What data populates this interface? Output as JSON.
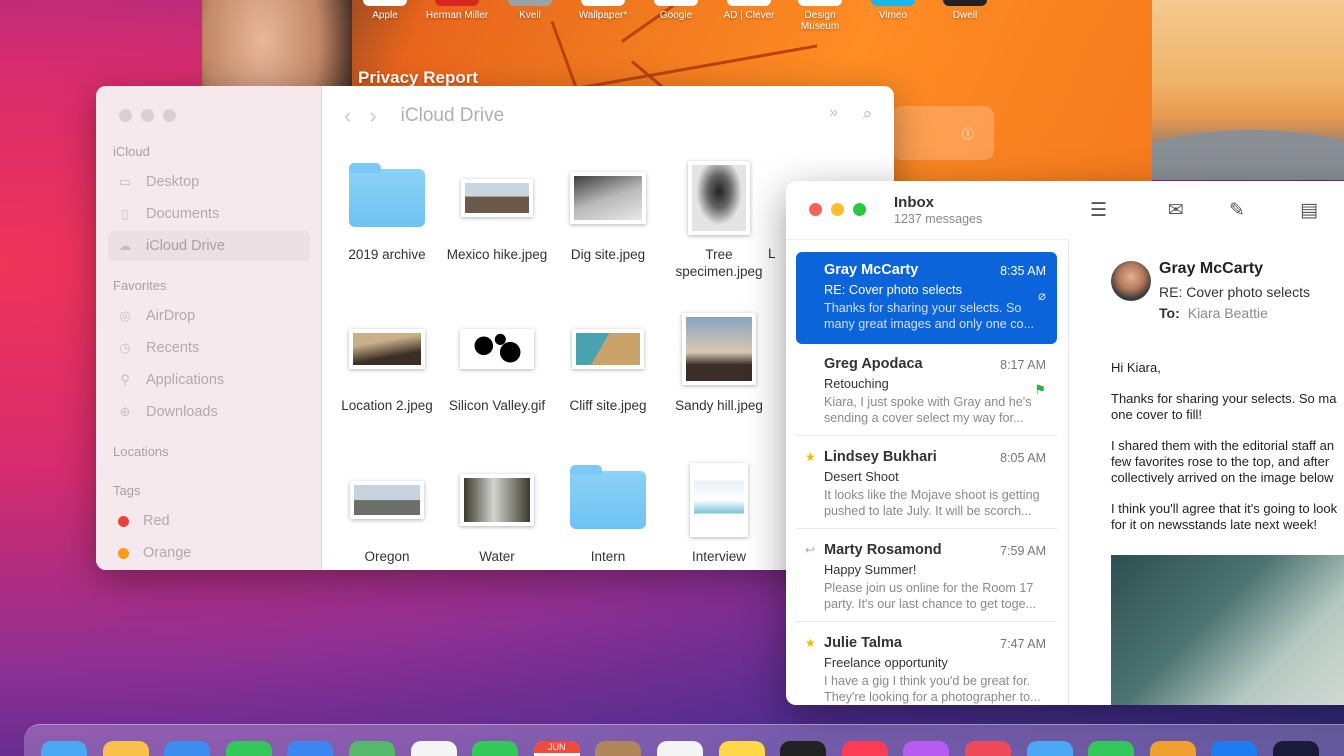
{
  "safari": {
    "favorites": [
      "Apple",
      "Herman Miller",
      "Kvell",
      "Wallpaper*",
      "Google",
      "AD | Clever",
      "Design Museum",
      "Vimeo",
      "Dwell"
    ],
    "privacy_title": "Privacy Report"
  },
  "finder": {
    "title": "iCloud Drive",
    "sections": {
      "icloud": "iCloud",
      "favorites": "Favorites",
      "locations": "Locations",
      "tags": "Tags"
    },
    "icloud_items": [
      {
        "label": "Desktop",
        "icon": "desktop-icon"
      },
      {
        "label": "Documents",
        "icon": "documents-icon"
      },
      {
        "label": "iCloud Drive",
        "icon": "cloud-icon",
        "selected": true
      }
    ],
    "favorite_items": [
      {
        "label": "AirDrop",
        "icon": "airdrop-icon"
      },
      {
        "label": "Recents",
        "icon": "clock-icon"
      },
      {
        "label": "Applications",
        "icon": "applications-icon"
      },
      {
        "label": "Downloads",
        "icon": "download-icon"
      }
    ],
    "tags": [
      {
        "label": "Red",
        "color": "#e8443a"
      },
      {
        "label": "Orange",
        "color": "#f59d18"
      }
    ],
    "files": [
      {
        "name": "2019 archive",
        "kind": "folder"
      },
      {
        "name": "Mexico hike.jpeg",
        "kind": "photo",
        "colors": [
          "#c8d6e0",
          "#6b5a4a"
        ]
      },
      {
        "name": "Dig site.jpeg",
        "kind": "photo",
        "colors": [
          "#d8d8d8",
          "#3c3c3c"
        ]
      },
      {
        "name": "Tree specimen.jpeg",
        "kind": "photo",
        "colors": [
          "#e4e4e4",
          "#222"
        ]
      },
      {
        "name": "Location 2.jpeg",
        "kind": "photo",
        "colors": [
          "#c9b08a",
          "#3b2e22"
        ]
      },
      {
        "name": "Silicon Valley.gif",
        "kind": "photo",
        "colors": [
          "#fff",
          "#000"
        ]
      },
      {
        "name": "Cliff site.jpeg",
        "kind": "photo",
        "colors": [
          "#4aa3b0",
          "#c9a36a"
        ]
      },
      {
        "name": "Sandy hill.jpeg",
        "kind": "photo",
        "colors": [
          "#d8c9b0",
          "#3a2e28"
        ]
      },
      {
        "name": "Oregon",
        "kind": "photo",
        "colors": [
          "#c8d2dc",
          "#6a6f6a"
        ]
      },
      {
        "name": "Water",
        "kind": "photo",
        "colors": [
          "#cfd5cf",
          "#3e3a2c"
        ]
      },
      {
        "name": "Intern",
        "kind": "folder"
      },
      {
        "name": "Interview",
        "kind": "doc"
      }
    ],
    "cut_label": "L"
  },
  "mail": {
    "title": "Inbox",
    "subtitle": "1237 messages",
    "toolbar_icons": [
      "filter-icon",
      "envelope-icon",
      "compose-icon",
      "archive-icon"
    ],
    "messages": [
      {
        "from": "Gray McCarty",
        "time": "8:35 AM",
        "subject": "RE: Cover photo selects",
        "preview": "Thanks for sharing your selects. So many great images and only one co...",
        "selected": true,
        "mark": "attachment"
      },
      {
        "from": "Greg Apodaca",
        "time": "8:17 AM",
        "subject": "Retouching",
        "preview": "Kiara, I just spoke with Gray and he's sending a cover select my way for...",
        "mark": "flag"
      },
      {
        "from": "Lindsey Bukhari",
        "time": "8:05 AM",
        "subject": "Desert Shoot",
        "preview": "It looks like the Mojave shoot is getting pushed to late July. It will be scorch...",
        "mark": "star"
      },
      {
        "from": "Marty Rosamond",
        "time": "7:59 AM",
        "subject": "Happy Summer!",
        "preview": "Please join us online for the Room 17 party. It's our last chance to get toge...",
        "mark": "reply"
      },
      {
        "from": "Julie Talma",
        "time": "7:47 AM",
        "subject": "Freelance opportunity",
        "preview": "I have a gig I think you'd be great for. They're looking for a photographer to...",
        "mark": "star"
      }
    ],
    "reader": {
      "from": "Gray McCarty",
      "subject": "RE: Cover photo selects",
      "to_label": "To:",
      "to": "Kiara Beattie",
      "greeting": "Hi Kiara,",
      "para1": "Thanks for sharing your selects. So ma\none cover to fill!",
      "para2": "I shared them with the editorial staff an\nfew favorites rose to the top, and after \ncollectively arrived on the image below",
      "para3": "I think you'll agree that it's going to look\nfor it on newsstands late next week!"
    }
  },
  "dock": {
    "calendar_month": "JUN",
    "colors": [
      "#4aa8f5",
      "#f7c14a",
      "#3b8df0",
      "#34c759",
      "#3b86f0",
      "#56b86a",
      "#f4f4f4",
      "#34c759",
      "#fff",
      "#b0865a",
      "#f4f4f4",
      "#ffd84a",
      "#222",
      "#fa3c55",
      "#b65cf0",
      "#f04a5a",
      "#4aa8f5",
      "#34c759",
      "#f0a030",
      "#1c7cf0",
      "#1a1a3a"
    ]
  }
}
